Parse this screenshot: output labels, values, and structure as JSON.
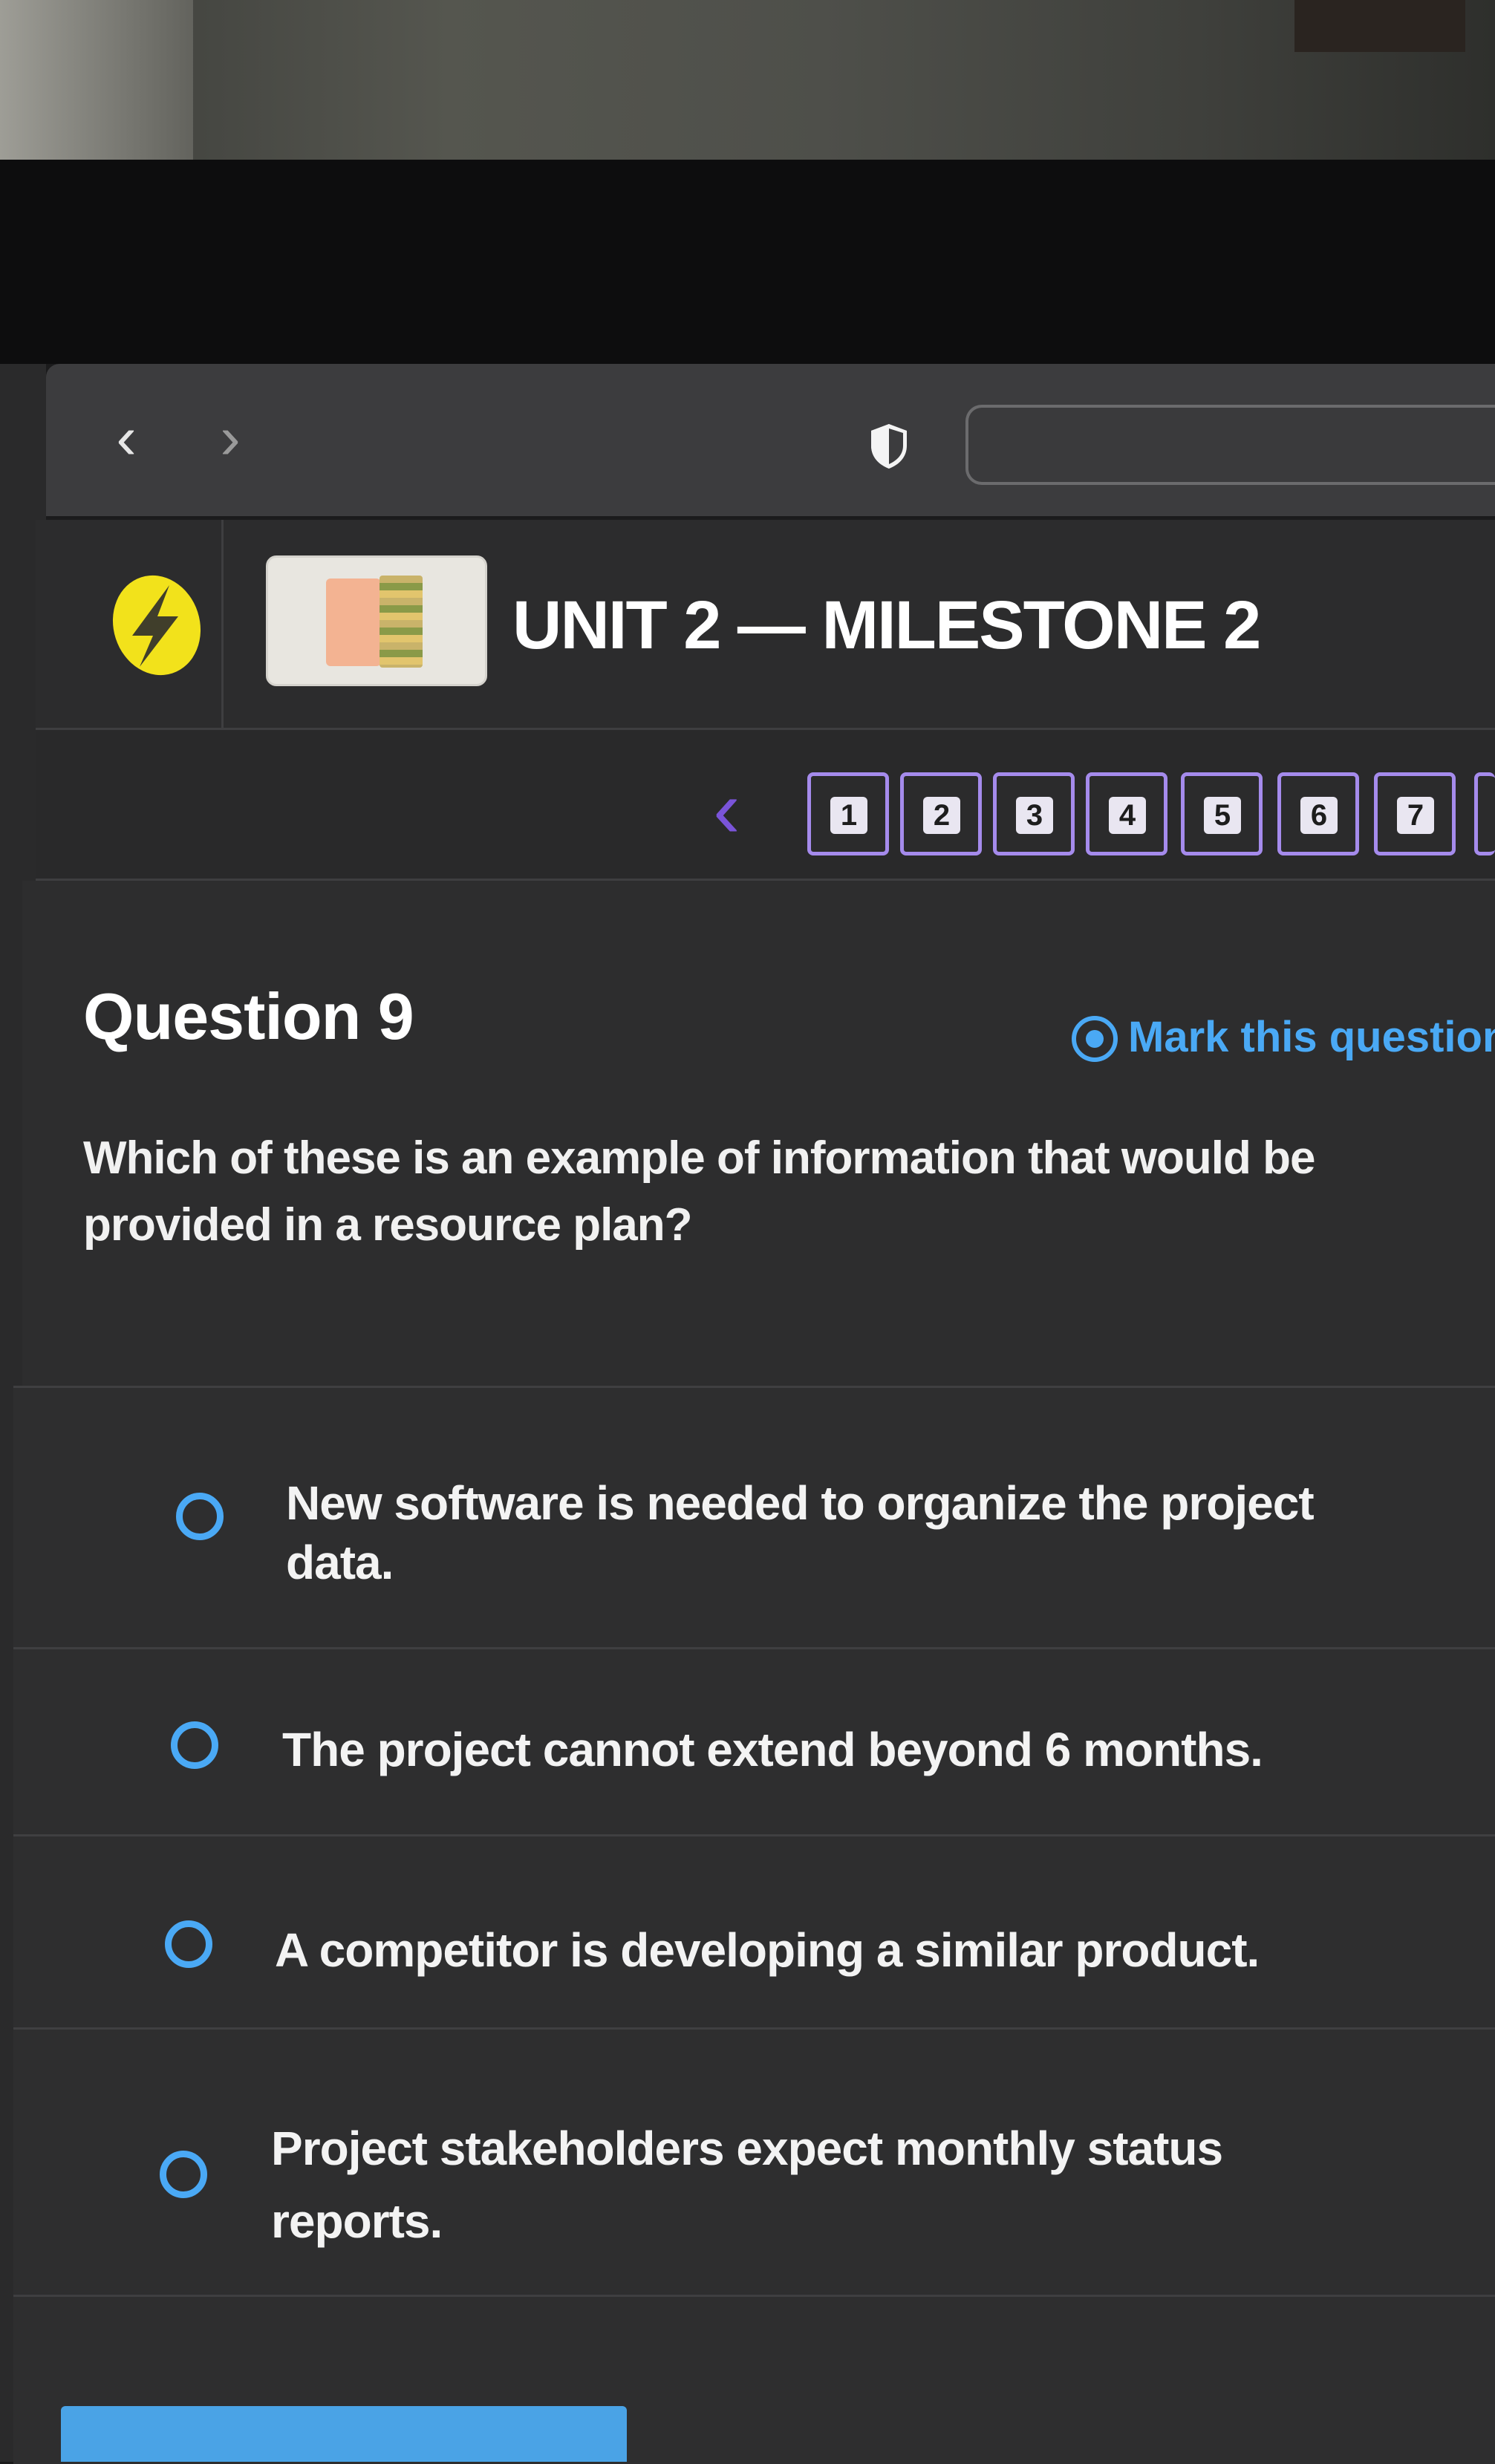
{
  "browser": {
    "back_glyph": "‹",
    "forward_glyph": "›",
    "icons": [
      "back-icon",
      "forward-icon",
      "shield-icon"
    ]
  },
  "header": {
    "title": "UNIT 2 — MILESTONE 2",
    "logo_color": "#f2e21b"
  },
  "question_nav": {
    "prev_glyph": "‹",
    "numbers": [
      "1",
      "2",
      "3",
      "4",
      "5",
      "6",
      "7"
    ],
    "accent": "#a58bec"
  },
  "question": {
    "title": "Question 9",
    "mark_label": "Mark this question",
    "text": "Which of these is an example of information that would be provided in a resource plan?"
  },
  "options": [
    {
      "line1": "New software is needed to organize the project",
      "line2": "data."
    },
    {
      "line1": "The project cannot extend beyond 6 months.",
      "line2": ""
    },
    {
      "line1": "A competitor is developing a similar product.",
      "line2": ""
    },
    {
      "line1": "Project stakeholders expect monthly status",
      "line2": "reports."
    }
  ],
  "colors": {
    "accent_blue": "#4aa9f5",
    "background": "#2d2d2e"
  }
}
